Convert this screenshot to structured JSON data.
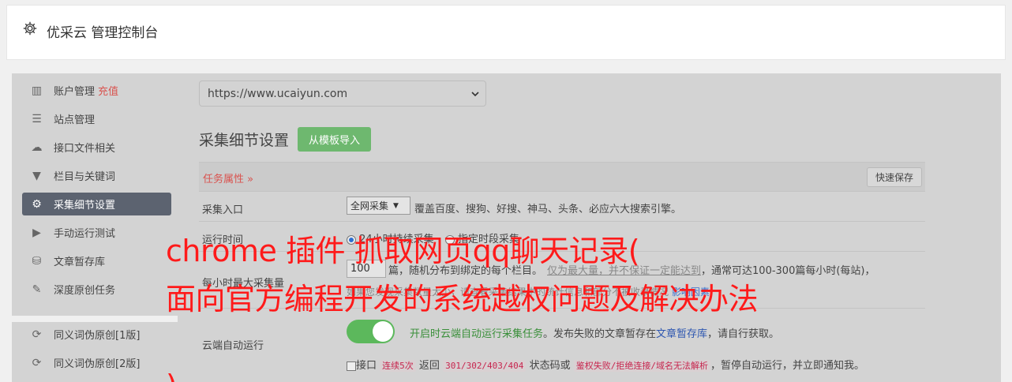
{
  "header": {
    "title": "优采云 管理控制台"
  },
  "sidebar": {
    "items": [
      {
        "label": "账户管理",
        "extra": "充值",
        "icon": "bar-chart-icon"
      },
      {
        "label": "站点管理",
        "icon": "server-icon"
      },
      {
        "label": "接口文件相关",
        "icon": "cloud-upload-icon"
      },
      {
        "label": "栏目与关键词",
        "icon": "filter-icon"
      },
      {
        "label": "采集细节设置",
        "icon": "gears-icon",
        "active": true
      },
      {
        "label": "手动运行测试",
        "icon": "play-circle-icon"
      },
      {
        "label": "文章暂存库",
        "icon": "database-icon"
      },
      {
        "label": "深度原创任务",
        "icon": "edit-icon"
      }
    ],
    "items2": [
      {
        "label": "同义词伪原创[1版]",
        "icon": "refresh-icon"
      },
      {
        "label": "同义词伪原创[2版]",
        "icon": "refresh-icon"
      }
    ]
  },
  "main": {
    "site_select": "https://www.ucaiyun.com",
    "section_title": "采集细节设置",
    "template_button": "从模板导入",
    "task_label": "任务属性 »",
    "quick_save": "快速保存",
    "entry": {
      "label": "采集入口",
      "select": "全网采集",
      "desc": "覆盖百度、搜狗、好搜、神马、头条、必应六大搜索引擎。"
    },
    "runtime": {
      "label": "运行时间",
      "opt1": "24小时持续采集",
      "opt2": "指定时段采集"
    },
    "hourly": {
      "label": "每小时最大采集量",
      "value": "100",
      "desc": "篇，随机分布到绑定的每个栏目。",
      "muted": "仅为最大量，并不保证一定能达到",
      "desc2": "，通常可达100-300篇每小时(每站)，",
      "note": "如果您发现采集数量太少，请查看采集结果中的统计信息和部分不被收录情况",
      "note_link": "影响因素"
    },
    "cloud": {
      "label": "云端自动运行",
      "desc_green": "开启时云端自动运行采集任务",
      "desc_mid": "。发布失败的文章暂存在",
      "desc_link": "文章暂存库",
      "desc_end": "，请自行获取。",
      "toggle_on": true
    },
    "iface": {
      "prefix": "接口",
      "code1": "连续5次",
      "mid1": "返回",
      "code2": "301/302/403/404",
      "mid2": "状态码或",
      "code3": "鉴权失败/拒绝连接/域名无法解析",
      "suffix": "，暂停自动运行，并立即通知我。"
    }
  },
  "overlay": {
    "line1": "chrome 插件 抓取网页qq聊天记录(",
    "line2": "面向官方编程开发的系统越权问题及解决办法",
    "line3": ")"
  },
  "colors": {
    "accent_green": "#5cb85c",
    "danger": "#d9534f",
    "overlay_red": "#ff1a1a"
  }
}
